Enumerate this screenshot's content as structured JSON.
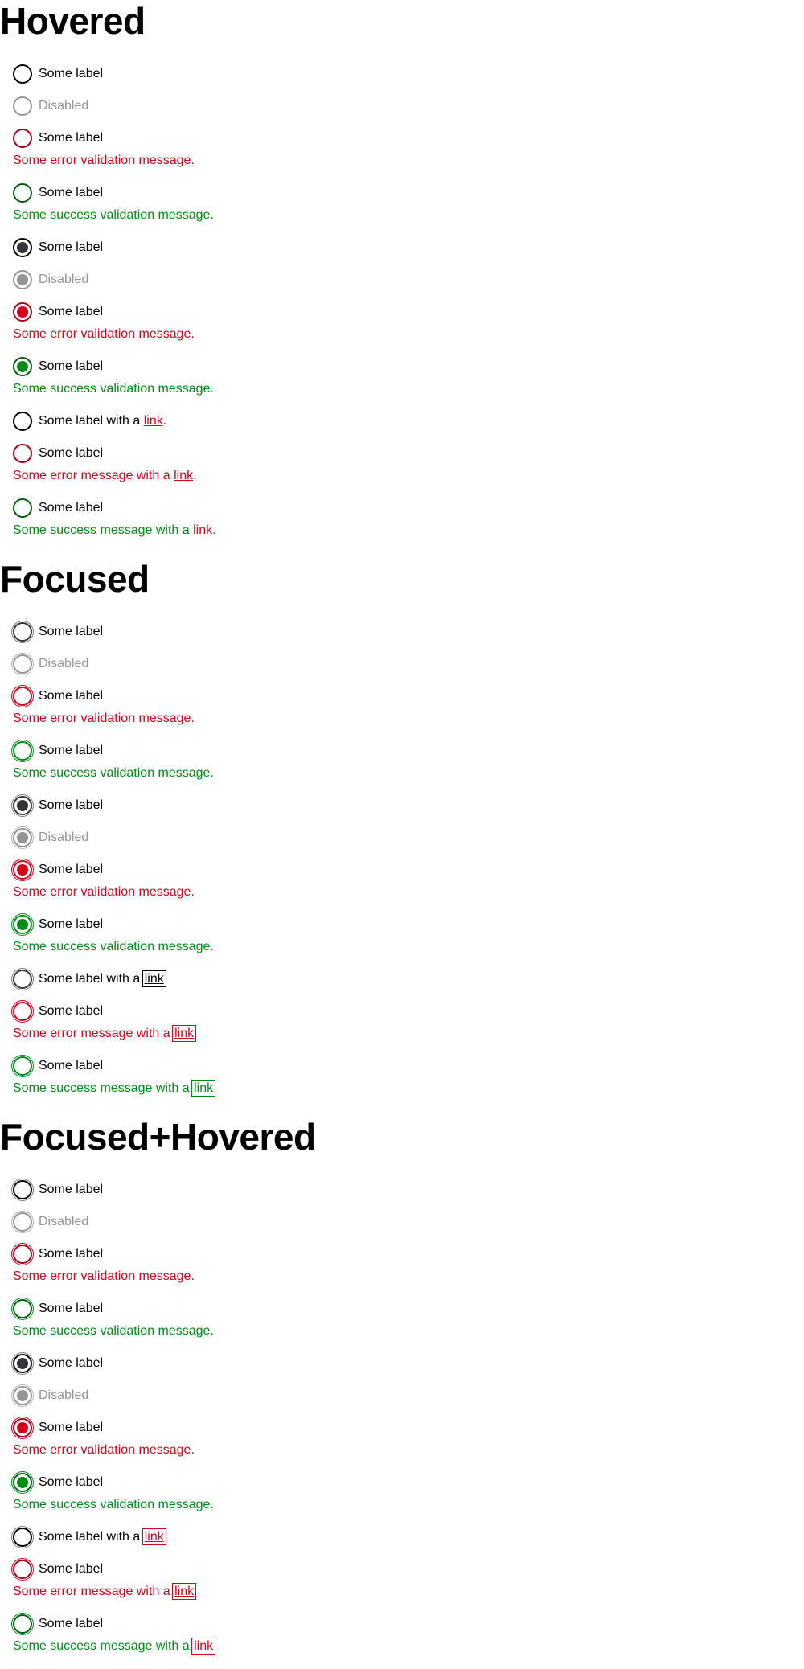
{
  "sections": [
    {
      "title": "Hovered",
      "items": {
        "label": "Some label",
        "disabled": "Disabled",
        "error_msg": "Some error validation message.",
        "success_msg": "Some success validation message.",
        "link_label_prefix": "Some label with a ",
        "link_text": "link",
        "period": ".",
        "error_link_prefix": "Some error message with a ",
        "success_link_prefix": "Some success message with a "
      }
    },
    {
      "title": "Focused",
      "items": {
        "label": "Some label",
        "disabled": "Disabled",
        "error_msg": "Some error validation message.",
        "success_msg": "Some success validation message.",
        "link_label_prefix": "Some label with a ",
        "link_text": "link",
        "period": "",
        "error_link_prefix": "Some error message with a ",
        "success_link_prefix": "Some success message with a "
      }
    },
    {
      "title": "Focused+Hovered",
      "items": {
        "label": "Some label",
        "disabled": "Disabled",
        "error_msg": "Some error validation message.",
        "success_msg": "Some success validation message.",
        "link_label_prefix": "Some label with a ",
        "link_text": "link",
        "period": "",
        "error_link_prefix": "Some error message with a ",
        "success_link_prefix": "Some success message with a "
      }
    }
  ],
  "colors": {
    "default": "#323639",
    "disabled": "#959595",
    "error": "#d5001c",
    "success": "#018a16"
  }
}
